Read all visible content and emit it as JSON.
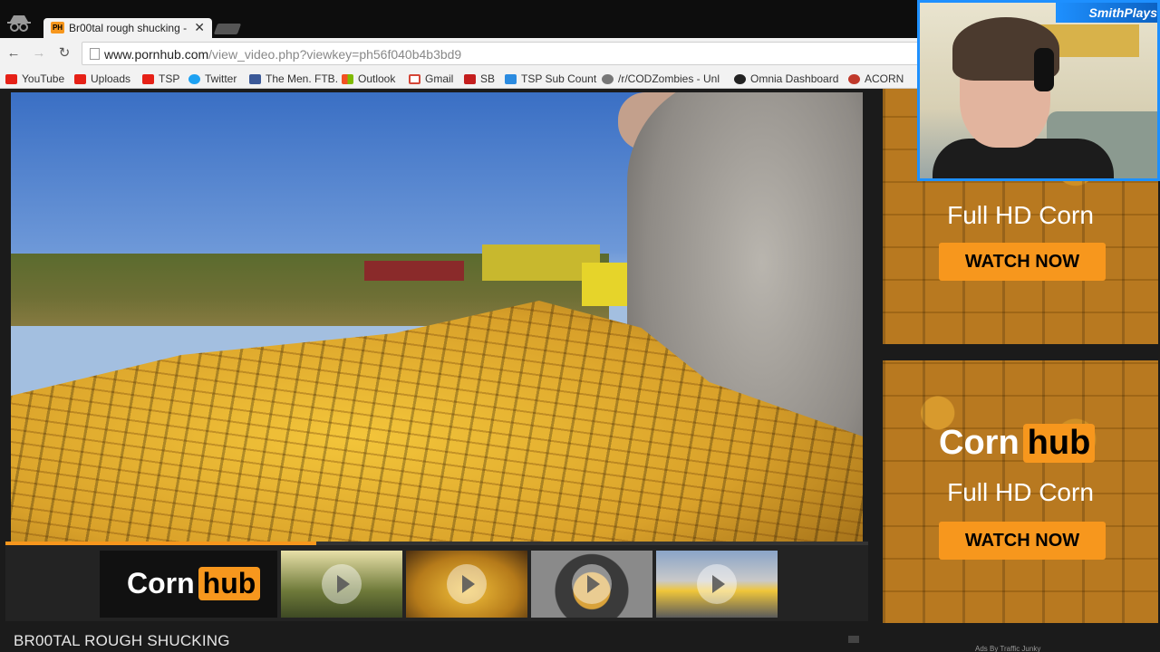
{
  "browser": {
    "tab_title": "Br00tal rough shucking - ",
    "tab_favicon": "PH",
    "url_host": "www.pornhub.com",
    "url_path": "/view_video.php?viewkey=ph56f040b4b3bd9"
  },
  "bookmarks": [
    {
      "label": "YouTube",
      "icon": "youtube-icon",
      "color": "#e62117"
    },
    {
      "label": "Uploads",
      "icon": "youtube-icon",
      "color": "#e62117"
    },
    {
      "label": "TSP",
      "icon": "youtube-icon",
      "color": "#e62117"
    },
    {
      "label": "Twitter",
      "icon": "twitter-icon",
      "color": "#1da1f2"
    },
    {
      "label": "The Men. FTB.",
      "icon": "facebook-icon",
      "color": "#3b5998"
    },
    {
      "label": "Outlook",
      "icon": "windows-icon",
      "color": "#f25022"
    },
    {
      "label": "Gmail",
      "icon": "gmail-icon",
      "color": "#d44638"
    },
    {
      "label": "SB",
      "icon": "chart-icon",
      "color": "#c41e1e"
    },
    {
      "label": "TSP Sub Count",
      "icon": "window-icon",
      "color": "#2b8be0"
    },
    {
      "label": "/r/CODZombies - Unl",
      "icon": "reddit-icon",
      "color": "#777777"
    },
    {
      "label": "Omnia Dashboard",
      "icon": "omnia-icon",
      "color": "#222222"
    },
    {
      "label": "ACORN",
      "icon": "acorn-icon",
      "color": "#c0392b"
    }
  ],
  "player": {
    "progress": 0.36
  },
  "related": {
    "brand_left": "Corn",
    "brand_right": "hub",
    "thumbnails": [
      "related-video-1",
      "related-video-2",
      "related-video-3",
      "related-video-4"
    ]
  },
  "video_title": "BR00TAL ROUGH SHUCKING",
  "ads": [
    {
      "tagline": "Full HD Corn",
      "cta": "WATCH NOW"
    },
    {
      "brand_left": "Corn",
      "brand_right": "hub",
      "tagline": "Full HD Corn",
      "cta": "WATCH NOW"
    }
  ],
  "ads_by": "Ads By Traffic Junky",
  "webcam": {
    "banner": "SmithPlays"
  },
  "colors": {
    "accent": "#f7971d",
    "webcam_border": "#1e90ff"
  }
}
